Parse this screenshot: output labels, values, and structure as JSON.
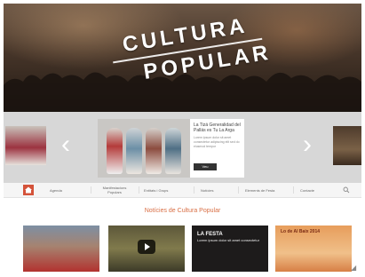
{
  "hero": {
    "title_line1": "CULTURA",
    "title_line2": "POPULAR"
  },
  "slider": {
    "prev_icon": "chevron-left-icon",
    "next_icon": "chevron-right-icon",
    "slide": {
      "title": "La Tizá Generalidad del Pallás es Tu La Arga",
      "body": "Lorem ipsum dolor sit amet consectetur adipiscing elit sed do eiusmod tempor",
      "button_label": "Veu"
    }
  },
  "nav": {
    "home_icon": "home-icon",
    "items": [
      "Agenda",
      "Manifestacions Populars",
      "Entitats i Grups",
      "Notícies",
      "Elements de Festa",
      "Contacte"
    ],
    "search_icon": "search-icon"
  },
  "section": {
    "title": "Notícies de Cultura Popular"
  },
  "thumbnails": {
    "items": [
      {
        "caption": ""
      },
      {
        "caption": ""
      },
      {
        "caption_big": "LA FESTA",
        "caption_small": "Lorem ipsum dolor sit amet consectetur"
      },
      {
        "caption": "Lo de Al Baix 2014"
      }
    ],
    "play_icon": "play-icon"
  },
  "colors": {
    "accent": "#d96f45",
    "home_button": "#d4533a",
    "slider_bg": "#d7d7d7"
  }
}
